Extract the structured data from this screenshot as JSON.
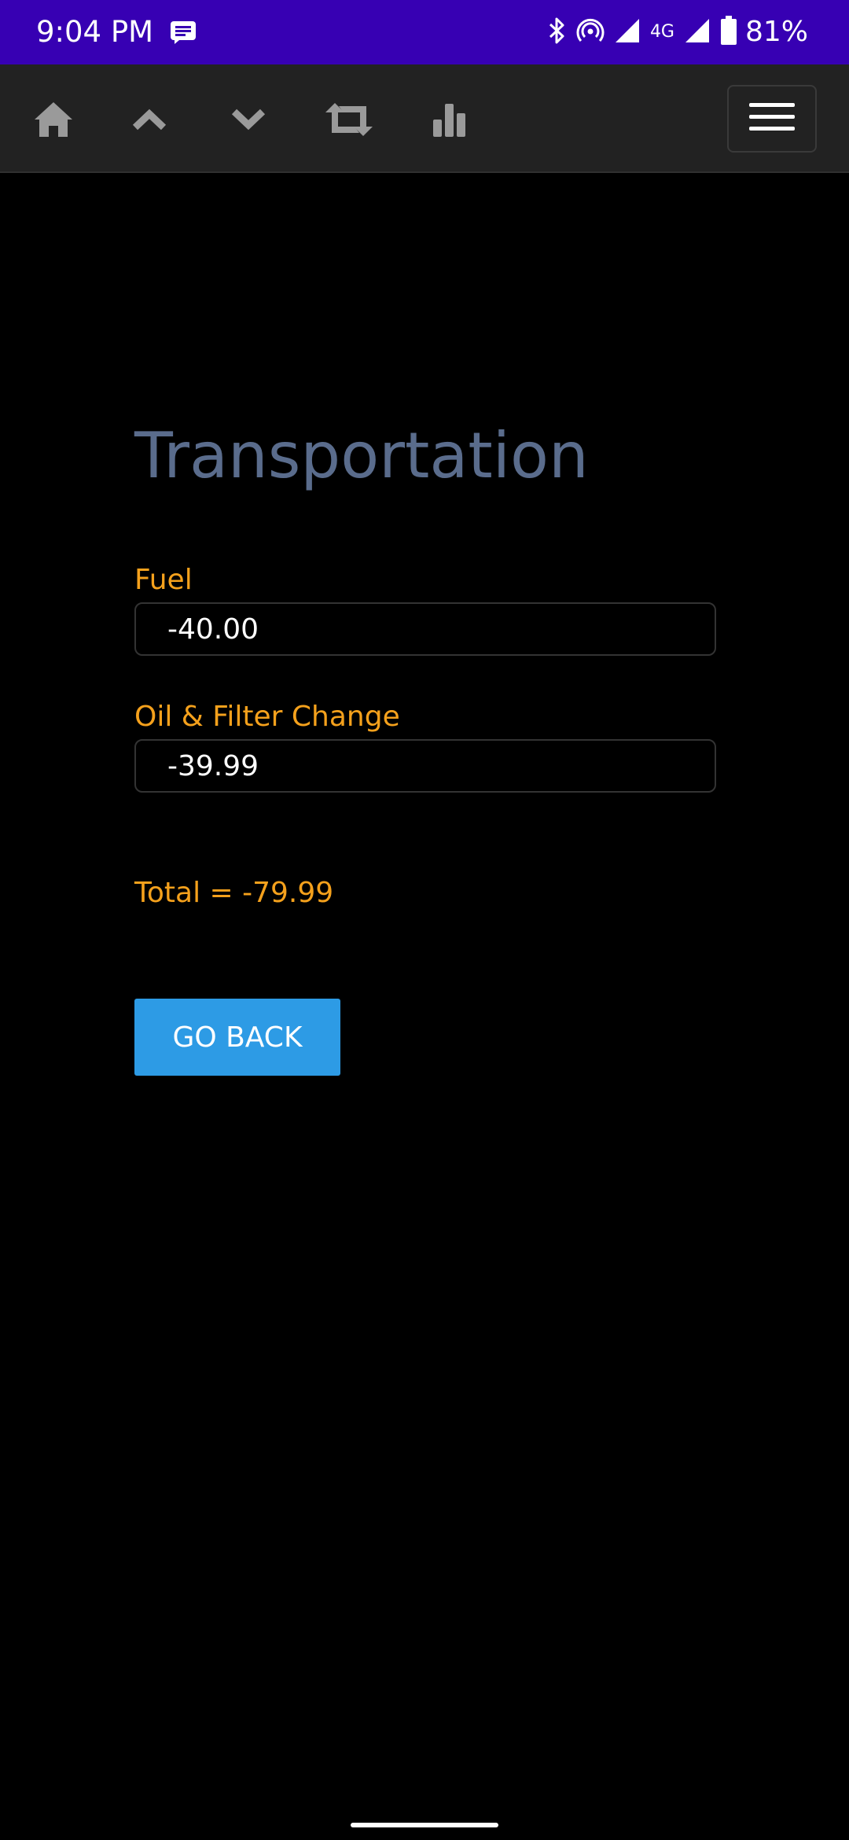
{
  "status_bar": {
    "time": "9:04 PM",
    "network": "4G",
    "battery": "81%",
    "background": "#3700b3",
    "icons": [
      "message-icon",
      "bluetooth-icon",
      "hotspot-icon",
      "signal-icon",
      "signal-icon",
      "battery-icon"
    ]
  },
  "toolbar": {
    "buttons": [
      "home-icon",
      "chevron-up-icon",
      "chevron-down-icon",
      "retweet-icon",
      "bar-chart-icon"
    ],
    "menu": "hamburger-menu-icon"
  },
  "page": {
    "title": "Transportation",
    "fields": [
      {
        "label": "Fuel",
        "value": "-40.00"
      },
      {
        "label": "Oil & Filter Change",
        "value": "-39.99"
      }
    ],
    "total": "Total = -79.99",
    "go_back_label": "GO BACK"
  },
  "colors": {
    "accent": "#f5a11c",
    "title": "#5a6c8c",
    "button": "#2d9be5"
  }
}
